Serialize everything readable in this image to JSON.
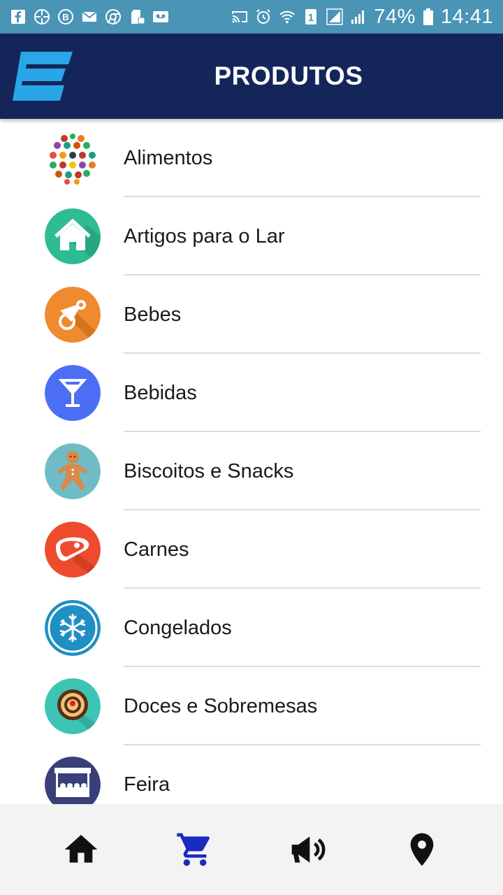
{
  "status_bar": {
    "battery_percent": "74%",
    "time": "14:41",
    "left_icons": [
      "facebook-icon",
      "shutter-icon",
      "b-icon",
      "mail-icon",
      "chrome-icon",
      "sd-card-icon",
      "voicemail-icon"
    ],
    "right_icons": [
      "cast-icon",
      "alarm-icon",
      "wifi-icon",
      "sim-1-icon",
      "signal-icon",
      "signal-icon",
      "battery-icon"
    ]
  },
  "app_bar": {
    "title": "PRODUTOS",
    "logo": "logo-e"
  },
  "categories": [
    {
      "label": "Alimentos",
      "icon": "food-icon",
      "color": "#ffffff"
    },
    {
      "label": "Artigos para o Lar",
      "icon": "house-icon",
      "color": "#2ebd92"
    },
    {
      "label": "Bebes",
      "icon": "pacifier-icon",
      "color": "#ef8a2f"
    },
    {
      "label": "Bebidas",
      "icon": "cocktail-glass-icon",
      "color": "#4b6ef5"
    },
    {
      "label": "Biscoitos e Snacks",
      "icon": "gingerbread-icon",
      "color": "#6fbcc6"
    },
    {
      "label": "Carnes",
      "icon": "steak-icon",
      "color": "#ee4b2e"
    },
    {
      "label": "Congelados",
      "icon": "snowflake-icon",
      "color": "#1f8fc4"
    },
    {
      "label": "Doces e Sobremesas",
      "icon": "tart-icon",
      "color": "#3ec4b4"
    },
    {
      "label": "Feira",
      "icon": "market-stall-icon",
      "color": "#3a3f7a"
    }
  ],
  "bottom_nav": [
    {
      "name": "home",
      "icon": "home-icon",
      "color": "#111111"
    },
    {
      "name": "products",
      "icon": "cart-icon",
      "color": "#1a2bbf"
    },
    {
      "name": "promotions",
      "icon": "megaphone-icon",
      "color": "#111111"
    },
    {
      "name": "location",
      "icon": "location-pin-icon",
      "color": "#111111"
    }
  ],
  "colors": {
    "status_bar": "#4a94b6",
    "app_bar": "#14255a",
    "accent": "#1a2bbf",
    "logo": "#29a6e8"
  }
}
